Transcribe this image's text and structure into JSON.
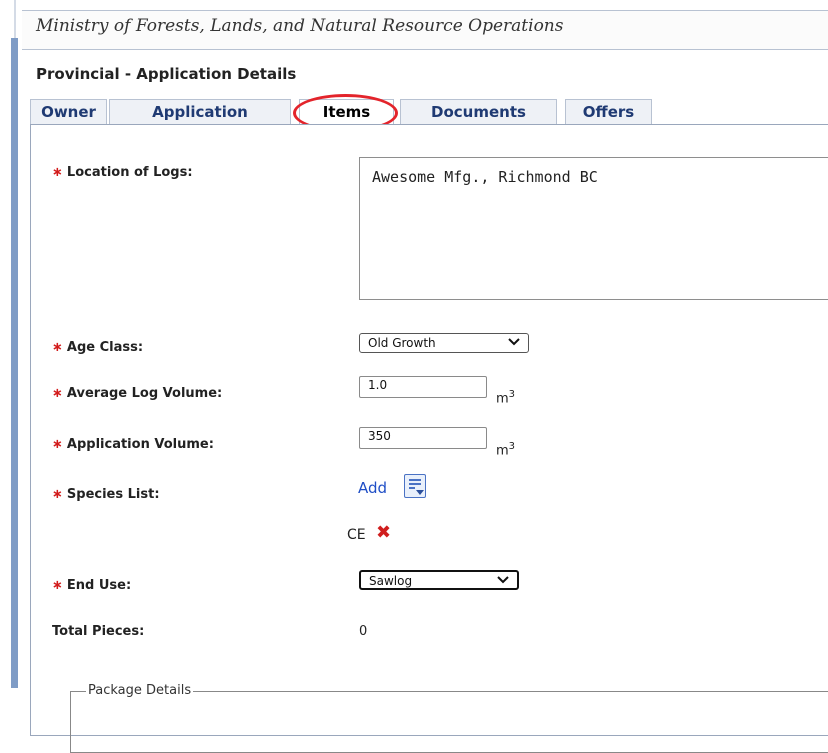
{
  "header": {
    "ministry": "Ministry of Forests, Lands, and Natural Resource Operations"
  },
  "page": {
    "subtitle": "Provincial - Application Details"
  },
  "tabs": [
    {
      "label": "Owner",
      "active": false
    },
    {
      "label": "Application",
      "active": false
    },
    {
      "label": "Items",
      "active": true
    },
    {
      "label": "Documents",
      "active": false
    },
    {
      "label": "Offers",
      "active": false
    }
  ],
  "form": {
    "required_mark": "∗",
    "location": {
      "label": "Location of Logs:",
      "value": "Awesome Mfg., Richmond BC"
    },
    "age_class": {
      "label": "Age Class:",
      "value": "Old Growth"
    },
    "avg_volume": {
      "label": "Average Log Volume:",
      "value": "1.0",
      "unit": "m",
      "unit_sup": "3"
    },
    "app_volume": {
      "label": "Application Volume:",
      "value": "350",
      "unit": "m",
      "unit_sup": "3"
    },
    "species": {
      "label": "Species List:",
      "add_label": "Add",
      "items": [
        "CE"
      ],
      "delete_glyph": "✖"
    },
    "end_use": {
      "label": "End Use:",
      "value": "Sawlog"
    },
    "total_pieces": {
      "label": "Total Pieces:",
      "value": "0"
    },
    "package": {
      "legend": "Package Details"
    }
  },
  "colors": {
    "required": "#d21b1b",
    "link": "#1f4ec6",
    "highlight_circle": "#e3242b"
  }
}
